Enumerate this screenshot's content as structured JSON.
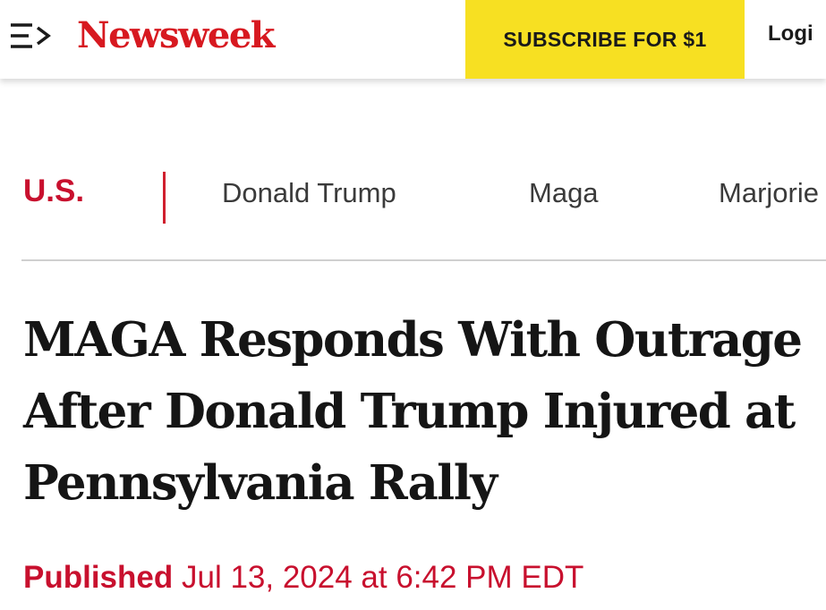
{
  "header": {
    "menu_icon": "menu-arrow-icon",
    "logo_text": "Newsweek",
    "subscribe_label": "SUBSCRIBE FOR $1",
    "login_label": "Logi"
  },
  "nav": {
    "section": "U.S.",
    "tags": [
      "Donald Trump",
      "Maga",
      "Marjorie"
    ]
  },
  "article": {
    "headline": "MAGA Responds With Outrage After Donald Trump Injured at Pennsylvania Rally",
    "published_label": "Published",
    "published_date": "Jul 13, 2024 at 6:42 PM EDT"
  },
  "colors": {
    "brand_red": "#d71920",
    "subscribe_yellow": "#f7e022",
    "divider_gray": "#cfcfcf"
  }
}
